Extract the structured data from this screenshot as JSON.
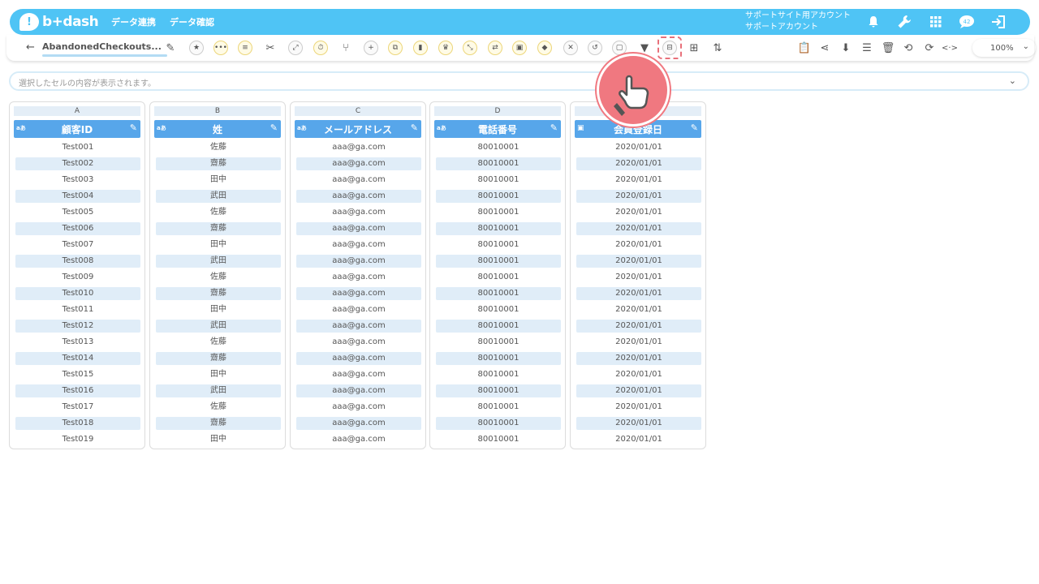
{
  "header": {
    "logo_text": "b+dash",
    "nav": [
      "データ連携",
      "データ確認"
    ],
    "account_line1": "サポートサイト用アカウント",
    "account_line2": "サポートアカウント",
    "icons": [
      "bell-icon",
      "wrench-icon",
      "apps-grid-icon",
      "chat-icon",
      "logout-icon"
    ]
  },
  "toolbar": {
    "back": "←",
    "sheet_name": "AbandonedCheckouts...",
    "zoom": "100%",
    "left_icons": [
      "pencil-icon",
      "star-icon",
      "more-icon",
      "notes-icon",
      "tools-icon",
      "expand-icon",
      "timer-icon",
      "merge-icon",
      "add-icon",
      "copy-icon",
      "delete-icon",
      "crown-icon",
      "shrink-icon",
      "swap-icon",
      "lock-icon",
      "cube-icon",
      "cancel-icon",
      "convert-icon",
      "frame-icon",
      "filter-icon",
      "split-column-icon",
      "table-icon",
      "compare-icon"
    ],
    "right_icons": [
      "clipboard-icon",
      "share-icon",
      "download-icon",
      "list-icon",
      "trash-icon",
      "history-icon",
      "refresh-icon",
      "code-icon"
    ]
  },
  "cell_display": {
    "placeholder": "選択したセルの内容が表示されます。"
  },
  "columns": [
    {
      "letter": "A",
      "type": "aあ",
      "name": "顧客ID",
      "values": [
        "Test001",
        "Test002",
        "Test003",
        "Test004",
        "Test005",
        "Test006",
        "Test007",
        "Test008",
        "Test009",
        "Test010",
        "Test011",
        "Test012",
        "Test013",
        "Test014",
        "Test015",
        "Test016",
        "Test017",
        "Test018",
        "Test019"
      ]
    },
    {
      "letter": "B",
      "type": "aあ",
      "name": "姓",
      "values": [
        "佐藤",
        "齋藤",
        "田中",
        "武田",
        "佐藤",
        "齋藤",
        "田中",
        "武田",
        "佐藤",
        "齋藤",
        "田中",
        "武田",
        "佐藤",
        "齋藤",
        "田中",
        "武田",
        "佐藤",
        "齋藤",
        "田中"
      ]
    },
    {
      "letter": "C",
      "type": "aあ",
      "name": "メールアドレス",
      "values": [
        "aaa@ga.com",
        "aaa@ga.com",
        "aaa@ga.com",
        "aaa@ga.com",
        "aaa@ga.com",
        "aaa@ga.com",
        "aaa@ga.com",
        "aaa@ga.com",
        "aaa@ga.com",
        "aaa@ga.com",
        "aaa@ga.com",
        "aaa@ga.com",
        "aaa@ga.com",
        "aaa@ga.com",
        "aaa@ga.com",
        "aaa@ga.com",
        "aaa@ga.com",
        "aaa@ga.com",
        "aaa@ga.com"
      ]
    },
    {
      "letter": "D",
      "type": "aあ",
      "name": "電話番号",
      "values": [
        "80010001",
        "80010001",
        "80010001",
        "80010001",
        "80010001",
        "80010001",
        "80010001",
        "80010001",
        "80010001",
        "80010001",
        "80010001",
        "80010001",
        "80010001",
        "80010001",
        "80010001",
        "80010001",
        "80010001",
        "80010001",
        "80010001"
      ]
    },
    {
      "letter": "",
      "type": "calendar",
      "name": "会員登録日",
      "values": [
        "2020/01/01",
        "2020/01/01",
        "2020/01/01",
        "2020/01/01",
        "2020/01/01",
        "2020/01/01",
        "2020/01/01",
        "2020/01/01",
        "2020/01/01",
        "2020/01/01",
        "2020/01/01",
        "2020/01/01",
        "2020/01/01",
        "2020/01/01",
        "2020/01/01",
        "2020/01/01",
        "2020/01/01",
        "2020/01/01",
        "2020/01/01"
      ]
    }
  ],
  "colors": {
    "brand": "#4fc4f5",
    "header_blue": "#57a6ea",
    "row_alt": "#e0edf8",
    "pointer": "#f07880"
  }
}
